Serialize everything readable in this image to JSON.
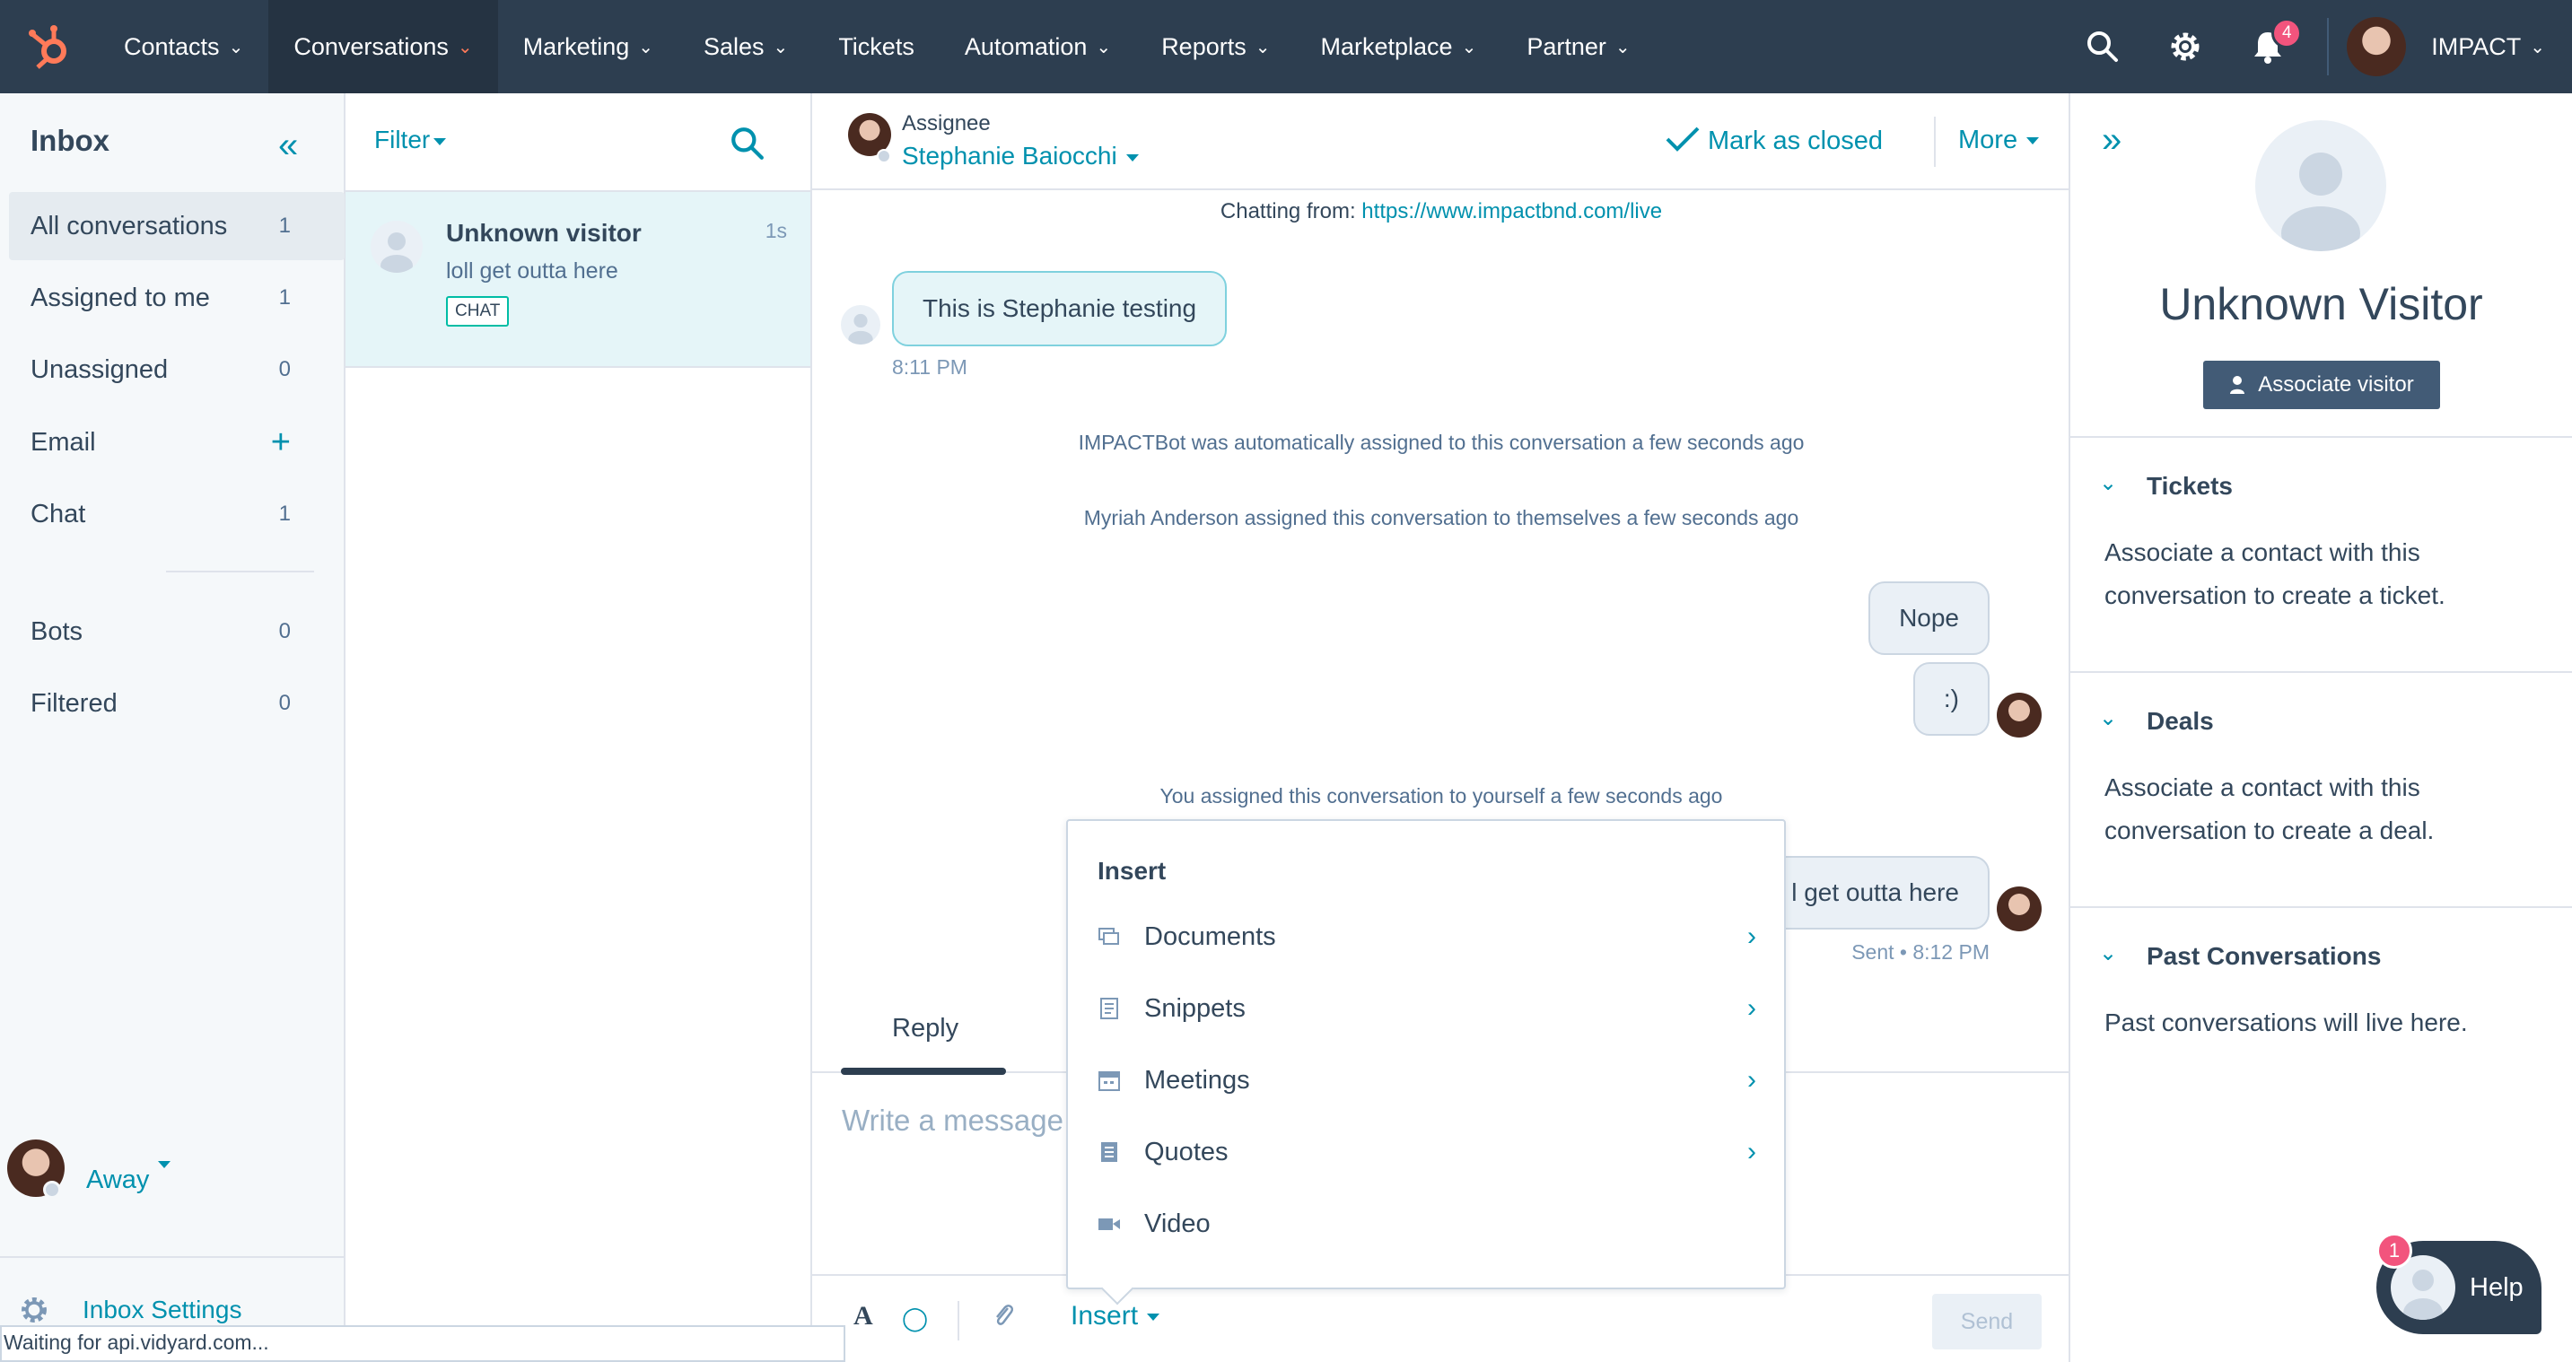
{
  "topnav": {
    "items": [
      "Contacts",
      "Conversations",
      "Marketing",
      "Sales",
      "Tickets",
      "Automation",
      "Reports",
      "Marketplace",
      "Partner"
    ],
    "notifications_count": "4",
    "account_name": "IMPACT"
  },
  "inbox": {
    "title": "Inbox",
    "items": [
      {
        "label": "All conversations",
        "count": "1"
      },
      {
        "label": "Assigned to me",
        "count": "1"
      },
      {
        "label": "Unassigned",
        "count": "0"
      },
      {
        "label": "Email",
        "count": "+"
      },
      {
        "label": "Chat",
        "count": "1"
      },
      {
        "label": "Bots",
        "count": "0"
      },
      {
        "label": "Filtered",
        "count": "0"
      }
    ],
    "status": "Away",
    "settings_label": "Inbox Settings"
  },
  "browser_status": "Waiting for api.vidyard.com...",
  "convlist": {
    "filter_label": "Filter",
    "card": {
      "name": "Unknown visitor",
      "time": "1s",
      "preview": "loll get outta here",
      "channel": "CHAT"
    }
  },
  "chat": {
    "assignee_label": "Assignee",
    "assignee_name": "Stephanie Baiocchi",
    "mark_closed": "Mark as closed",
    "more": "More",
    "chatting_from_label": "Chatting from:",
    "chatting_from_url": "https://www.impactbnd.com/live",
    "messages": [
      {
        "text": "This is Stephanie testing",
        "time": "8:11 PM"
      },
      {
        "text": "Nope"
      },
      {
        "text": ":)"
      },
      {
        "text": "l get outta here",
        "time": "Sent • 8:12 PM"
      }
    ],
    "system": [
      "IMPACTBot was automatically assigned to this conversation a few seconds ago",
      "Myriah Anderson assigned this conversation to themselves a few seconds ago",
      "You assigned this conversation to yourself a few seconds ago"
    ],
    "reply_tab": "Reply",
    "composer_placeholder": "Write a message",
    "insert_label": "Insert",
    "send_label": "Send"
  },
  "insert_menu": {
    "title": "Insert",
    "items": [
      "Documents",
      "Snippets",
      "Meetings",
      "Quotes",
      "Video"
    ]
  },
  "sidebar": {
    "contact_name": "Unknown Visitor",
    "associate_button": "Associate visitor",
    "sections": [
      {
        "title": "Tickets",
        "body": "Associate a contact with this conversation to create a ticket."
      },
      {
        "title": "Deals",
        "body": "Associate a contact with this conversation to create a deal."
      },
      {
        "title": "Past Conversations",
        "body": "Past conversations will live here."
      }
    ]
  },
  "help": {
    "label": "Help",
    "badge": "1"
  },
  "colors": {
    "accent": "#0091ae",
    "nav_bg": "#2d3e50",
    "brand_orange": "#ff7a59",
    "badge": "#f2547d"
  }
}
